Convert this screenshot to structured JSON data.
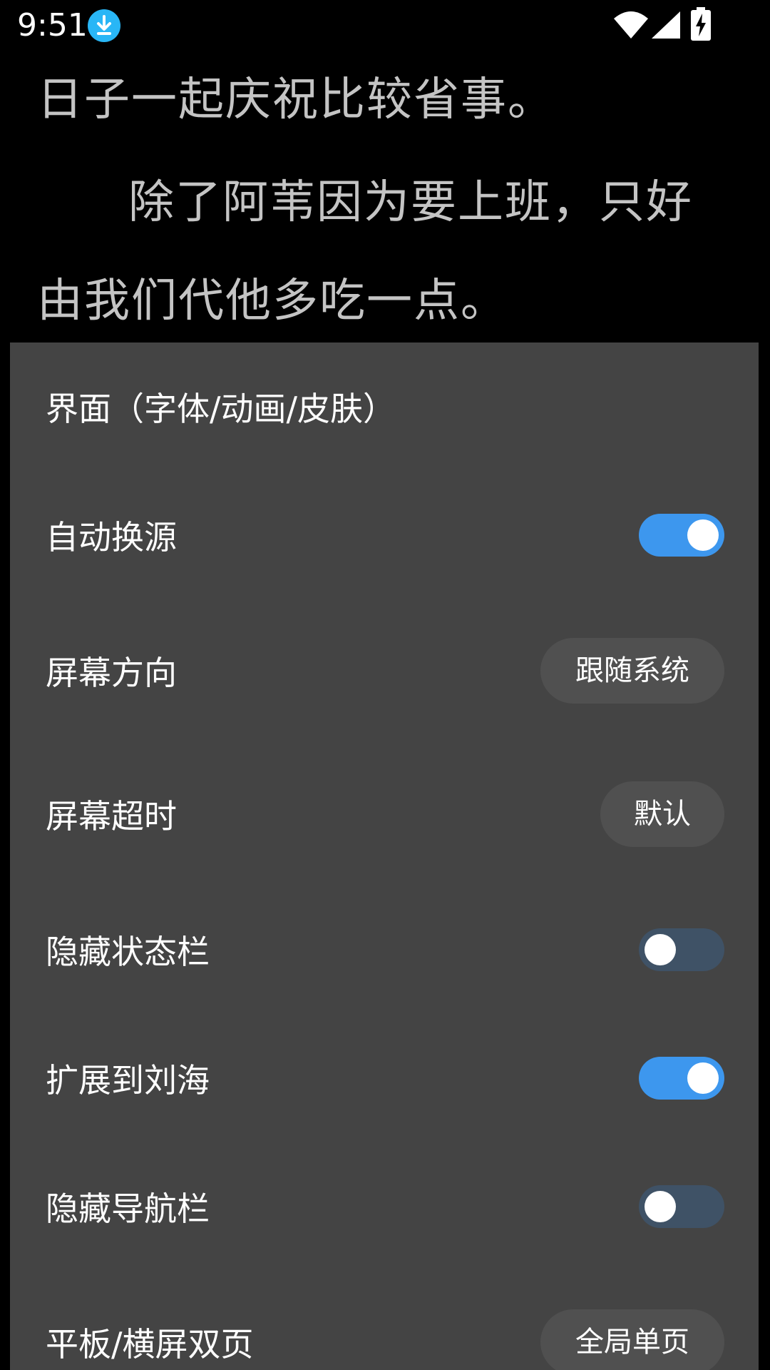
{
  "status_bar": {
    "time": "9:51",
    "icons": [
      "download-icon",
      "wifi-icon",
      "signal-icon",
      "battery-charging-icon"
    ]
  },
  "reader": {
    "lines": [
      "日子一起庆祝比较省事。",
      "除了阿苇因为要上班，只好",
      "由我们代他多吃一点。"
    ]
  },
  "settings": {
    "ui_label": "界面（字体/动画/皮肤）",
    "auto_source_label": "自动换源",
    "auto_source_on": true,
    "orientation_label": "屏幕方向",
    "orientation_value": "跟随系统",
    "timeout_label": "屏幕超时",
    "timeout_value": "默认",
    "hide_status_label": "隐藏状态栏",
    "hide_status_on": false,
    "notch_label": "扩展到刘海",
    "notch_on": true,
    "hide_nav_label": "隐藏导航栏",
    "hide_nav_on": false,
    "dual_page_label": "平板/横屏双页",
    "dual_page_value": "全局单页"
  },
  "colors": {
    "accent": "#3d97ee",
    "panel_bg": "#444444",
    "switch_off_track": "#3f5266",
    "pill_bg": "#505050"
  }
}
